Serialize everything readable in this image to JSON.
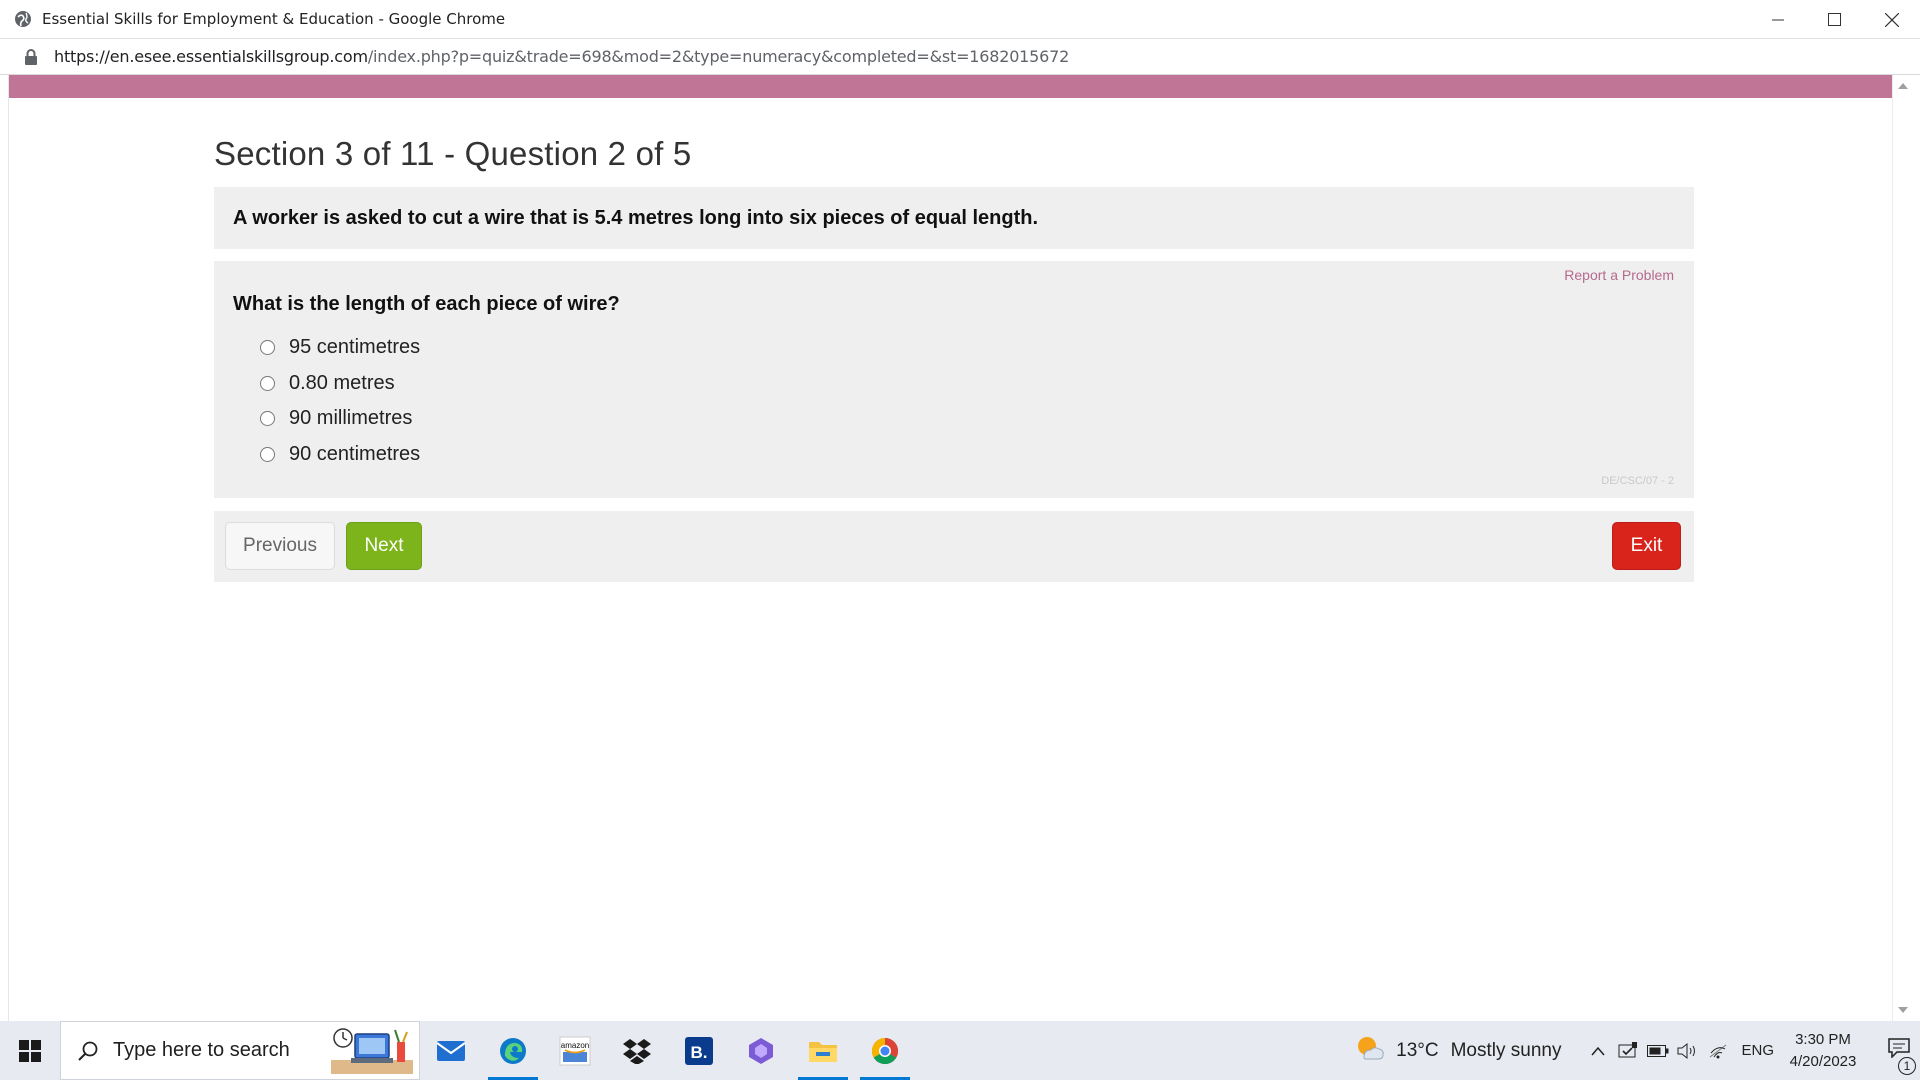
{
  "browser": {
    "window_title": "Essential Skills for Employment & Education - Google Chrome",
    "url_host": "https://en.esee.essentialskillsgroup.com",
    "url_path": "/index.php?p=quiz&trade=698&mod=2&type=numeracy&completed=&st=1682015672"
  },
  "quiz": {
    "heading": "Section 3 of 11  -  Question 2 of 5",
    "stem": "A worker is asked to cut a wire that is 5.4 metres long into six pieces of equal length.",
    "report_label": "Report a Problem",
    "question": "What is the length of each piece of wire?",
    "options": [
      "95 centimetres",
      "0.80 metres",
      "90 millimetres",
      "90 centimetres"
    ],
    "code": "DE/CSC/07 - 2",
    "prev_label": "Previous",
    "next_label": "Next",
    "exit_label": "Exit"
  },
  "colors": {
    "accent_bar": "#c07597",
    "next_green": "#7db31b",
    "exit_red": "#d9241c",
    "link_pink": "#b56a8d"
  },
  "taskbar": {
    "search_placeholder": "Type here to search",
    "apps": [
      "mail-icon",
      "edge-icon",
      "amazon-icon",
      "dropbox-icon",
      "booking-icon",
      "copilot-icon",
      "file-explorer-icon",
      "chrome-icon"
    ],
    "weather_temp": "13°C",
    "weather_condition": "Mostly sunny",
    "language": "ENG",
    "time": "3:30 PM",
    "date": "4/20/2023",
    "notification_count": "1"
  }
}
